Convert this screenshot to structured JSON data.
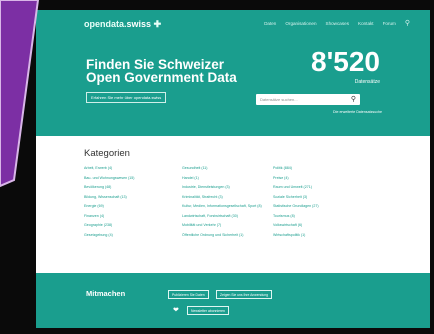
{
  "header": {
    "logo_part1": "opendata.",
    "logo_part2": "swiss",
    "logo_icon": "swiss-flag-icon",
    "nav": [
      "Daten",
      "Organisationen",
      "Showcases",
      "Kontakt",
      "Forum"
    ],
    "search_icon": "search-icon"
  },
  "hero": {
    "title_line1": "Finden Sie Schweizer",
    "title_line2": "Open Government Data",
    "cta_button": "Erfahren Sie mehr über opendata.swiss",
    "dataset_count": "8'520",
    "dataset_count_label": "Datensätze",
    "search_placeholder": "Datensätze suchen...",
    "search_link": "Die erweiterte Datensatzsuche"
  },
  "categories": {
    "title": "Kategorien",
    "columns": [
      [
        "Arbeit, Erwerb (4)",
        "Bau- und Wohnungswesen (15)",
        "Bevölkerung (48)",
        "Bildung, Wissenschaft (13)",
        "Energie (69)",
        "Finanzen (4)",
        "Geographie (238)",
        "Gesetzgebung (4)"
      ],
      [
        "Gesundheit (11)",
        "Handel (1)",
        "Industrie, Dienstleistungen (3)",
        "Kriminalität, Strafrecht (3)",
        "Kultur, Medien, Informationsgesellschaft, Sport (8)",
        "Landwirtschaft, Forstwirtschaft (30)",
        "Mobilität und Verkehr (7)",
        "Öffentliche Ordnung und Sicherheit (1)"
      ],
      [
        "Politik (884)",
        "Preise (4)",
        "Raum und Umwelt (271)",
        "Soziale Sicherheit (3)",
        "Statistische Grundlagen (27)",
        "Tourismus (8)",
        "Volkswirtschaft (6)",
        "Wirtschaftspolitik (1)"
      ]
    ]
  },
  "footer": {
    "title": "Mitmachen",
    "buttons": [
      "Publizieren Sie Daten",
      "Zeigen Sie uns Ihre Anwendung",
      "Newsletter abonnieren"
    ],
    "twitter_icon": "twitter-bird-icon"
  },
  "overlay": {
    "color": "#7c2fa4",
    "border_color": "#d9b6e8"
  }
}
